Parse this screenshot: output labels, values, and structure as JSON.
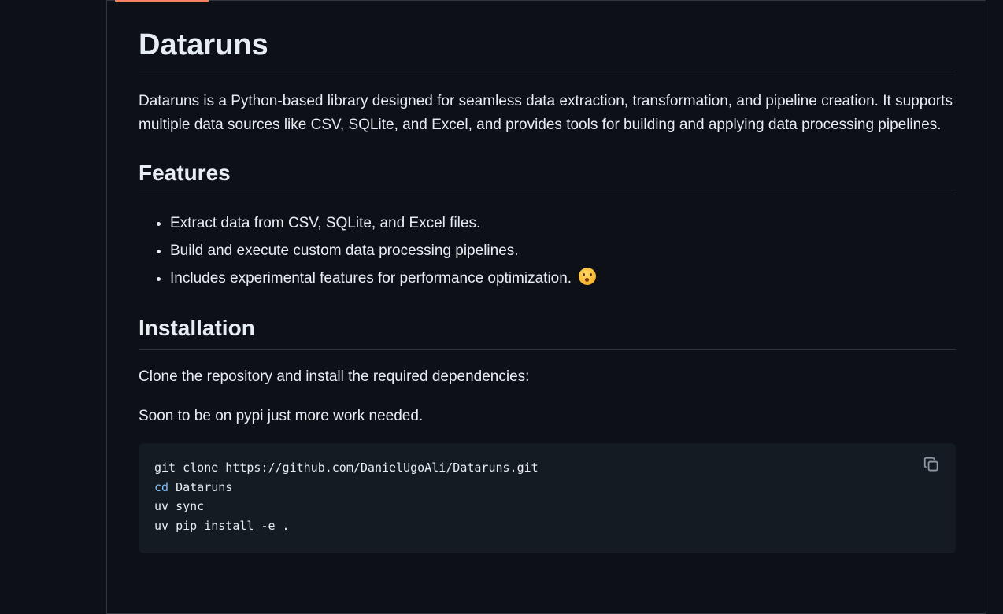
{
  "readme": {
    "title": "Dataruns",
    "intro": "Dataruns is a Python-based library designed for seamless data extraction, transformation, and pipeline creation. It supports multiple data sources like CSV, SQLite, and Excel, and provides tools for building and applying data processing pipelines.",
    "features": {
      "heading": "Features",
      "items": [
        "Extract data from CSV, SQLite, and Excel files.",
        "Build and execute custom data processing pipelines.",
        "Includes experimental features for performance optimization."
      ],
      "emoji_icon": "hushed-face-emoji-icon"
    },
    "installation": {
      "heading": "Installation",
      "clone_text": "Clone the repository and install the required dependencies:",
      "soon_text": "Soon to be on pypi just more work needed.",
      "code": {
        "line1": "git clone https://github.com/DanielUgoAli/Dataruns.git",
        "line2_keyword": "cd",
        "line2_rest": " Dataruns",
        "line3": "uv sync",
        "line4": "uv pip install -e ."
      },
      "copy_icon": "copy-icon"
    }
  },
  "colors": {
    "background": "#0d1117",
    "text": "#e6edf3",
    "border": "#30363d",
    "code_bg": "#151b23",
    "tab_accent": "#f78166",
    "keyword": "#79c0ff"
  }
}
